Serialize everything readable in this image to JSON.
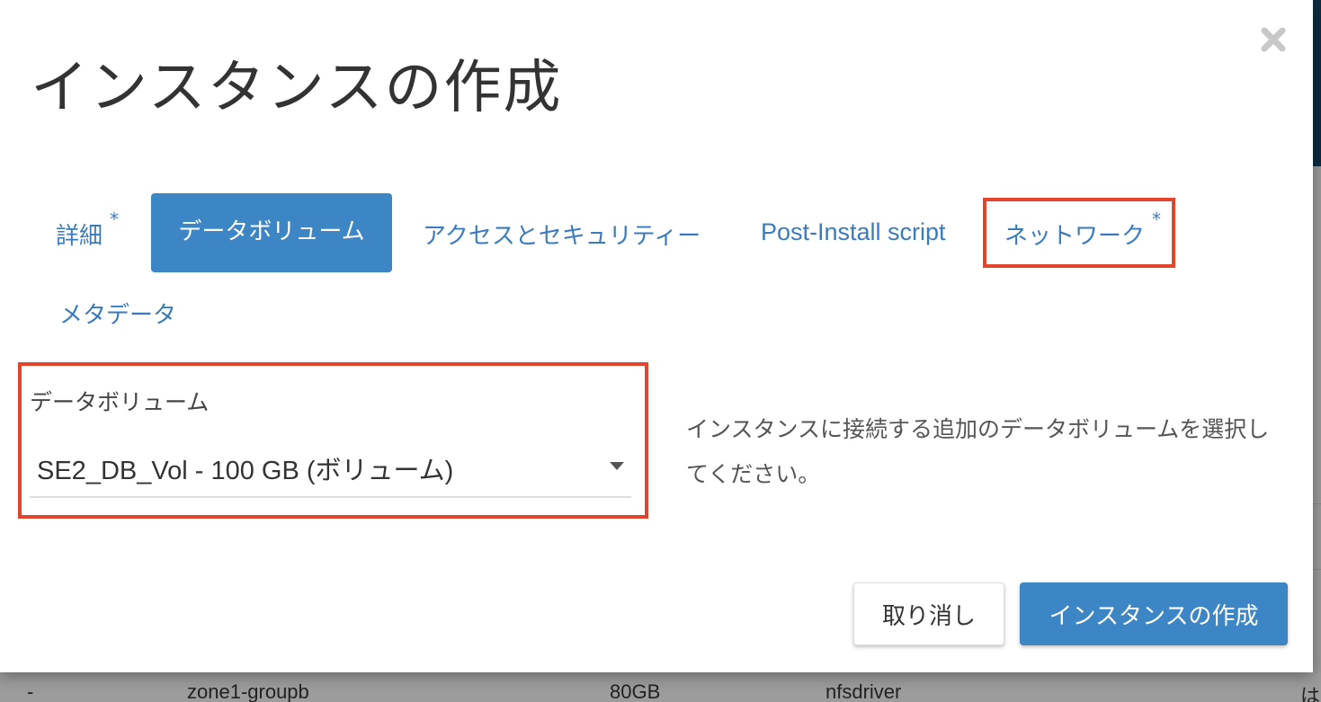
{
  "modal": {
    "title": "インスタンスの作成",
    "close_icon": "close-icon"
  },
  "tabs": [
    {
      "label": "詳細",
      "required": "*"
    },
    {
      "label": "データボリューム",
      "active": true
    },
    {
      "label": "アクセスとセキュリティー"
    },
    {
      "label": "Post-Install script"
    },
    {
      "label": "ネットワーク",
      "required": "*"
    },
    {
      "label": "メタデータ"
    }
  ],
  "data_volume": {
    "label": "データボリューム",
    "selected": "SE2_DB_Vol - 100 GB (ボリューム)",
    "help_text": "インスタンスに接続する追加のデータボリュームを選択してください。"
  },
  "footer": {
    "cancel_label": "取り消し",
    "create_label": "インスタンスの作成"
  },
  "background_row": {
    "dash": "-",
    "zone": "zone1-groupb",
    "size": "80GB",
    "driver": "nfsdriver",
    "trailing": "は"
  },
  "colors": {
    "accent": "#3c86c6",
    "highlight": "#e2452b"
  }
}
